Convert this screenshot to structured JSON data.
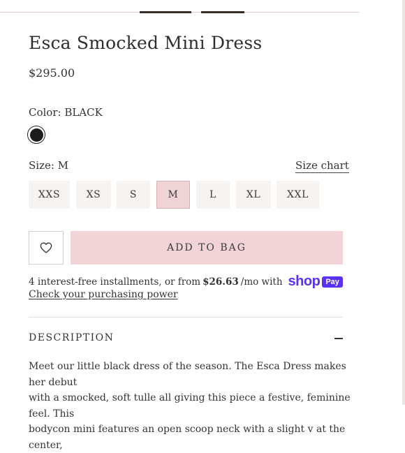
{
  "product": {
    "title": "Esca Smocked Mini Dress",
    "price": "$295.00"
  },
  "color": {
    "label": "Color: BLACK",
    "swatch": "#1c1c1c"
  },
  "size": {
    "label": "Size: M",
    "chart_link": "Size chart",
    "options": [
      "XXS",
      "XS",
      "S",
      "M",
      "L",
      "XL",
      "XXL"
    ],
    "selected": "M"
  },
  "actions": {
    "add_to_bag": "ADD TO BAG",
    "wishlist_icon": "heart-icon"
  },
  "payment": {
    "text_before": "4 interest-free installments, or from",
    "amount": "$26.63",
    "text_after": "/mo with",
    "brand": "shop",
    "brand_badge": "Pay",
    "check_link": "Check your purchasing power",
    "brand_color": "#5a31f4"
  },
  "description": {
    "heading": "DESCRIPTION",
    "toggle_icon": "minus-icon",
    "lines": [
      "Meet our little black dress of the season. The Esca Dress makes her debut",
      "with a smocked, soft tulle all giving this piece a festive, feminine feel. This",
      "bodycon mini features an open scoop neck with a slight v at the center,"
    ]
  },
  "colors": {
    "accent_pink": "#f2d3d8",
    "size_bg": "#f7f3f1"
  }
}
